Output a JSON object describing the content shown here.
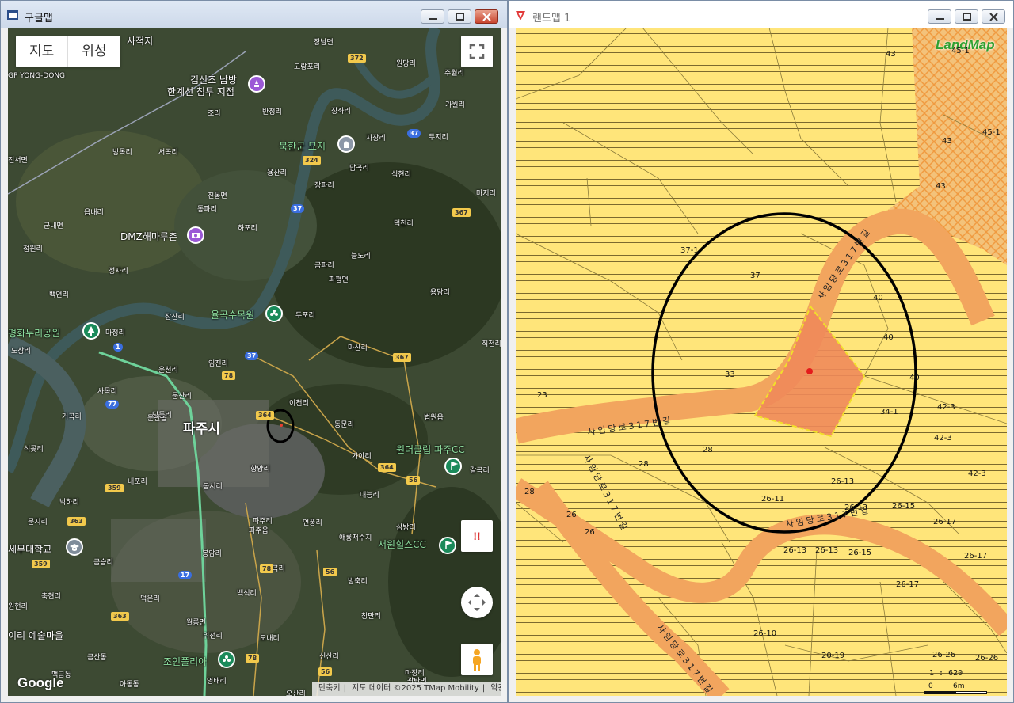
{
  "left_window": {
    "title": "구글맵",
    "map_type": {
      "map_label": "지도",
      "satellite_label": "위성"
    },
    "google_logo": "Google",
    "attribution": {
      "shortcuts": "단축키",
      "data": "지도 데이터 ©2025 TMap Mobility",
      "terms": "약관"
    },
    "streetview_warning": "!!",
    "big_labels": [
      {
        "text": "파주시"
      }
    ],
    "poi_labels": [
      {
        "text": "김신조 남방"
      },
      {
        "text": "한계선 침투 지점"
      },
      {
        "text": "북한군 묘지"
      },
      {
        "text": "DMZ해마루촌"
      },
      {
        "text": "율곡수목원"
      },
      {
        "text": "평화누리공원"
      },
      {
        "text": "원더클럽 파주CC"
      },
      {
        "text": "서원힐스CC"
      },
      {
        "text": "세무대학교"
      },
      {
        "text": "이리 예술마을"
      },
      {
        "text": "조인폴리아"
      },
      {
        "text": "사적지"
      }
    ],
    "place_labels": [
      "GP YONG-DONG",
      "장남면",
      "고랑포리",
      "원당리",
      "주월리",
      "반정리",
      "조리",
      "장좌리",
      "가월리",
      "자장리",
      "두지리",
      "방목리",
      "서곡리",
      "용산리",
      "답곡리",
      "식현리",
      "진서면",
      "진동면",
      "장파리",
      "마지리",
      "읍내리",
      "동파리",
      "하포리",
      "덕천리",
      "군내면",
      "금파리",
      "늘노리",
      "점원리",
      "정자리",
      "파평면",
      "백연리",
      "용담리",
      "마정리",
      "장산리",
      "두포리",
      "노상리",
      "사목리",
      "임진리",
      "마산리",
      "직천리",
      "운천리",
      "문산리",
      "문산읍",
      "당동리",
      "이천리",
      "동문리",
      "법원읍",
      "거곡리",
      "석곶리",
      "가야리",
      "갈곡리",
      "내포리",
      "향양리",
      "대능리",
      "낙하리",
      "봉서리",
      "문지리",
      "파주리",
      "연풍리",
      "파주읍",
      "삼방리",
      "애룡저수지",
      "금승리",
      "봉암리",
      "부곡리",
      "방축리",
      "축현리",
      "덕은리",
      "백석리",
      "창만리",
      "월롱면",
      "위전리",
      "도내리",
      "신산리",
      "금산동",
      "영태리",
      "마장리",
      "맥금동",
      "아동동",
      "광탄면",
      "오산리",
      "원현리"
    ],
    "shields": [
      "372",
      "37",
      "324",
      "37",
      "367",
      "37",
      "367",
      "1",
      "78",
      "364",
      "56",
      "364",
      "359",
      "363",
      "17",
      "77",
      "78",
      "56",
      "363",
      "56",
      "78",
      "359"
    ]
  },
  "right_window": {
    "title": "랜드맵 1",
    "logo": "LandMap",
    "scale_text": "1 : 620",
    "scale_zero": "0",
    "scale_unit": "6m",
    "road_labels": [
      "사임당로317번길",
      "사임당로317번길",
      "사임당로317번길",
      "사임당로317번길",
      "사임당로317번길"
    ],
    "parcel_labels": [
      "43",
      "45-1",
      "45-1",
      "43",
      "43",
      "37-1",
      "37",
      "40",
      "40",
      "40",
      "33",
      "23",
      "34-1",
      "42-3",
      "42-3",
      "28",
      "28",
      "28",
      "26-13",
      "26-11",
      "26-13",
      "26-15",
      "26",
      "26",
      "26-17",
      "26-13",
      "26-13",
      "26-15",
      "42-3",
      "26-17",
      "26-17",
      "26-10",
      "20-19",
      "26-26",
      "26-26"
    ]
  },
  "colors": {
    "titlebar": "#d6e0ee",
    "parcel_fill": "#ffe57a",
    "road_fill": "#f2a55e",
    "target_fill": "#f08a5a",
    "target_border": "#f2e02a",
    "ellipse": "#000000"
  }
}
